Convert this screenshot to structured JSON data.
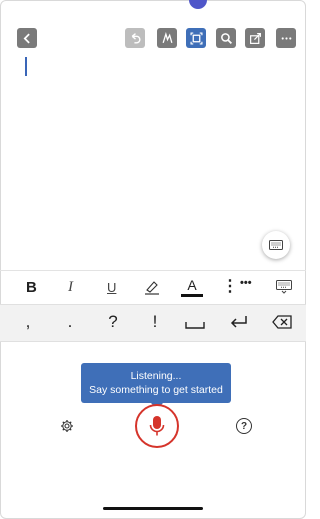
{
  "toolbar": {
    "buttons": [
      {
        "name": "back-button",
        "icon": "chevron-left-icon"
      },
      {
        "name": "undo-button",
        "icon": "undo-icon",
        "state": "disabled"
      },
      {
        "name": "draw-button",
        "icon": "pen-icon"
      },
      {
        "name": "focus-button",
        "icon": "frame-icon",
        "state": "active"
      },
      {
        "name": "search-button",
        "icon": "search-icon"
      },
      {
        "name": "share-button",
        "icon": "share-icon"
      },
      {
        "name": "more-button",
        "icon": "ellipsis-icon"
      }
    ]
  },
  "formatting": {
    "bold": "B",
    "italic": "I",
    "underline": "U",
    "font_color": "A",
    "more": "•••",
    "font_color_swatch": "#111111"
  },
  "punctuation": {
    "keys": [
      ",",
      ".",
      "?",
      "!"
    ]
  },
  "dictation": {
    "tooltip_line1": "Listening...",
    "tooltip_line2": "Say something to get started",
    "help": "?",
    "mic_color": "#d5342b"
  },
  "colors": {
    "accent": "#3f6fb8",
    "toolbar_button": "#7a7a7a"
  }
}
